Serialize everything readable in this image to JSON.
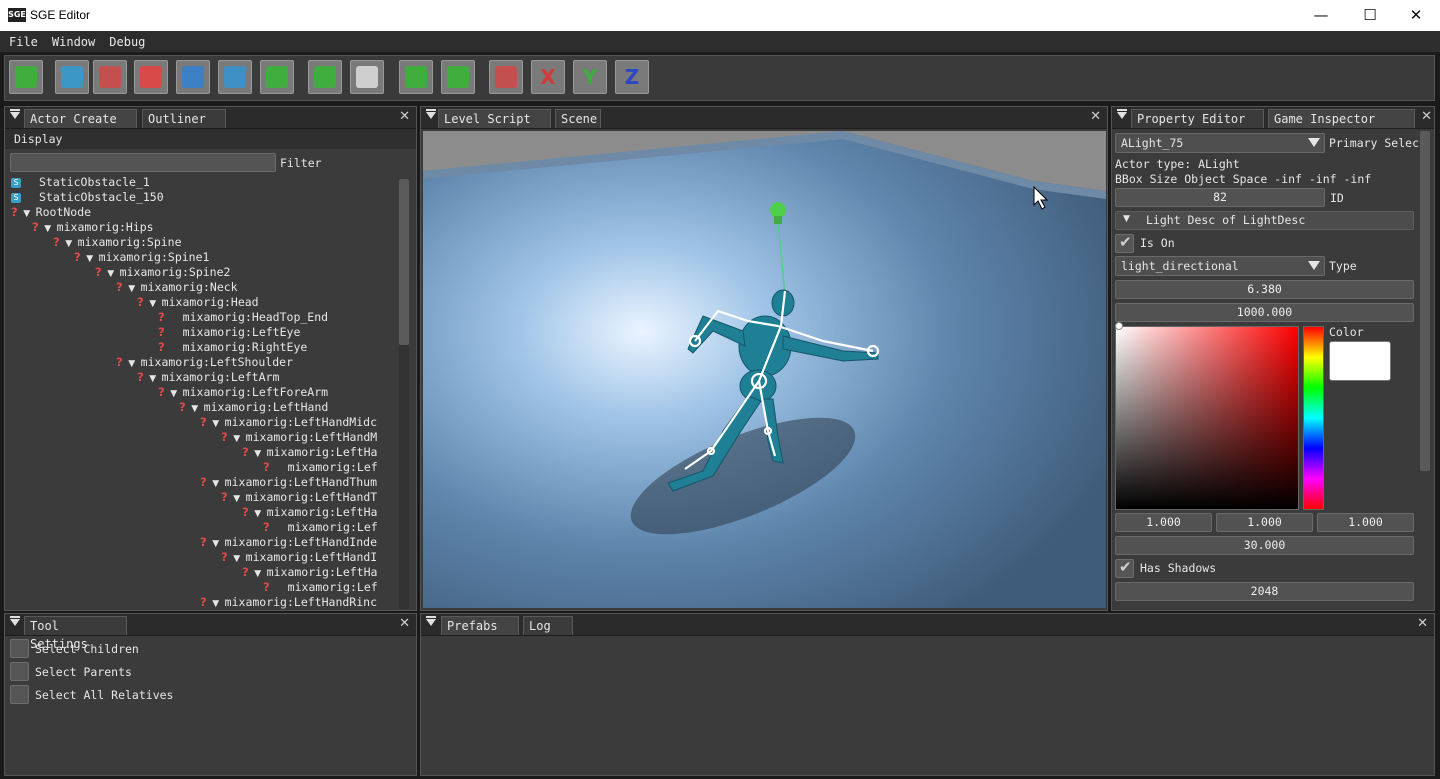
{
  "window": {
    "logo": "SGE",
    "title": "SGE Editor",
    "minimize": "—",
    "maximize": "☐",
    "close": "✕"
  },
  "menu": [
    "File",
    "Window",
    "Debug"
  ],
  "toolbar": {
    "buttons": [
      {
        "name": "play-icon",
        "color": "#3fae3f"
      },
      {
        "name": "triangle-icon",
        "color": "#3d97c6"
      },
      {
        "name": "terrain-icon",
        "color": "#c44f4f"
      },
      {
        "name": "rotate-icon",
        "color": "#d84a4a"
      },
      {
        "name": "mountains-icon",
        "color": "#3d7fc4"
      },
      {
        "name": "frame-icon",
        "color": "#3d8fc4"
      },
      {
        "name": "add-play-icon",
        "color": "#3fae3f"
      },
      {
        "name": "refresh-scene-icon",
        "color": "#3fae3f"
      },
      {
        "name": "window-icon",
        "color": "#cfcfcf"
      },
      {
        "name": "reload-icon",
        "color": "#3fae3f"
      },
      {
        "name": "green-cube-icon",
        "color": "#3fae3f"
      },
      {
        "name": "camera-icon",
        "color": "#c44f4f"
      }
    ],
    "axes": [
      {
        "label": "X",
        "color": "#d43a3a"
      },
      {
        "label": "Y",
        "color": "#3fae3f"
      },
      {
        "label": "Z",
        "color": "#2a46c4"
      }
    ]
  },
  "left_panel": {
    "tabs": [
      "Actor Create",
      "Outliner"
    ],
    "close": "✕",
    "display_label": "Display",
    "filter_label": "Filter",
    "filter_value": "",
    "tree": [
      {
        "icon": "S",
        "arrow": "",
        "label": "StaticObstacle_1",
        "depth": 0
      },
      {
        "icon": "S",
        "arrow": "",
        "label": "StaticObstacle_150",
        "depth": 0
      },
      {
        "icon": "?",
        "arrow": "▼",
        "label": "RootNode",
        "depth": 0
      },
      {
        "icon": "?",
        "arrow": "▼",
        "label": "mixamorig:Hips",
        "depth": 1
      },
      {
        "icon": "?",
        "arrow": "▼",
        "label": "mixamorig:Spine",
        "depth": 2
      },
      {
        "icon": "?",
        "arrow": "▼",
        "label": "mixamorig:Spine1",
        "depth": 3
      },
      {
        "icon": "?",
        "arrow": "▼",
        "label": "mixamorig:Spine2",
        "depth": 4
      },
      {
        "icon": "?",
        "arrow": "▼",
        "label": "mixamorig:Neck",
        "depth": 5
      },
      {
        "icon": "?",
        "arrow": "▼",
        "label": "mixamorig:Head",
        "depth": 6
      },
      {
        "icon": "?",
        "arrow": "",
        "label": "mixamorig:HeadTop_End",
        "depth": 7
      },
      {
        "icon": "?",
        "arrow": "",
        "label": "mixamorig:LeftEye",
        "depth": 7
      },
      {
        "icon": "?",
        "arrow": "",
        "label": "mixamorig:RightEye",
        "depth": 7
      },
      {
        "icon": "?",
        "arrow": "▼",
        "label": "mixamorig:LeftShoulder",
        "depth": 5
      },
      {
        "icon": "?",
        "arrow": "▼",
        "label": "mixamorig:LeftArm",
        "depth": 6
      },
      {
        "icon": "?",
        "arrow": "▼",
        "label": "mixamorig:LeftForeArm",
        "depth": 7
      },
      {
        "icon": "?",
        "arrow": "▼",
        "label": "mixamorig:LeftHand",
        "depth": 8
      },
      {
        "icon": "?",
        "arrow": "▼",
        "label": "mixamorig:LeftHandMidc",
        "depth": 9
      },
      {
        "icon": "?",
        "arrow": "▼",
        "label": "mixamorig:LeftHandM",
        "depth": 10
      },
      {
        "icon": "?",
        "arrow": "▼",
        "label": "mixamorig:LeftHa",
        "depth": 11
      },
      {
        "icon": "?",
        "arrow": "",
        "label": "mixamorig:Lef",
        "depth": 12
      },
      {
        "icon": "?",
        "arrow": "▼",
        "label": "mixamorig:LeftHandThum",
        "depth": 9
      },
      {
        "icon": "?",
        "arrow": "▼",
        "label": "mixamorig:LeftHandT",
        "depth": 10
      },
      {
        "icon": "?",
        "arrow": "▼",
        "label": "mixamorig:LeftHa",
        "depth": 11
      },
      {
        "icon": "?",
        "arrow": "",
        "label": "mixamorig:Lef",
        "depth": 12
      },
      {
        "icon": "?",
        "arrow": "▼",
        "label": "mixamorig:LeftHandInde",
        "depth": 9
      },
      {
        "icon": "?",
        "arrow": "▼",
        "label": "mixamorig:LeftHandI",
        "depth": 10
      },
      {
        "icon": "?",
        "arrow": "▼",
        "label": "mixamorig:LeftHa",
        "depth": 11
      },
      {
        "icon": "?",
        "arrow": "",
        "label": "mixamorig:Lef",
        "depth": 12
      },
      {
        "icon": "?",
        "arrow": "▼",
        "label": "mixamorig:LeftHandRinc",
        "depth": 9
      }
    ]
  },
  "center_panel": {
    "tabs": [
      "Level Script",
      "Scene"
    ],
    "close": "✕"
  },
  "right_panel": {
    "tabs": [
      "Property Editor",
      "Game Inspector Wind…"
    ],
    "close": "✕",
    "actor_select": "ALight_75",
    "primary_label": "Primary Selec",
    "actor_type": "Actor type: ALight",
    "bbox": "BBox Size Object Space  -inf -inf -inf",
    "id_value": "82",
    "id_label": "ID",
    "light_header": "Light Desc of LightDesc",
    "is_on_label": "Is On",
    "type_value": "light_directional",
    "type_label": "Type",
    "value1": "6.380",
    "value2": "1000.000",
    "color_label": "Color",
    "color_swatch": "#ffffff",
    "rgb": [
      "1.000",
      "1.000",
      "1.000"
    ],
    "value3": "30.000",
    "has_shadows_label": "Has Shadows",
    "shadow_size": "2048"
  },
  "tool_settings": {
    "tab": "Tool Settings",
    "close": "✕",
    "options": [
      "Select Children",
      "Select Parents",
      "Select All Relatives"
    ]
  },
  "bottom_panel": {
    "tabs": [
      "Prefabs",
      "Log"
    ],
    "close": "✕"
  }
}
